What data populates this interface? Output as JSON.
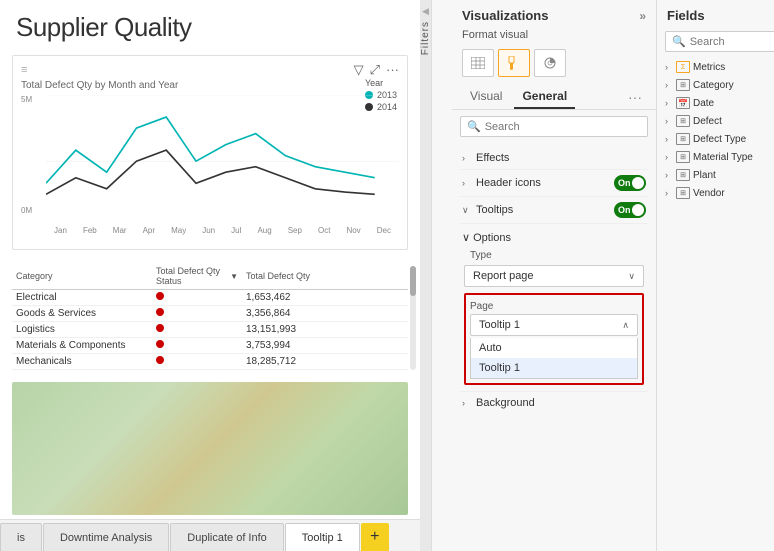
{
  "report": {
    "title": "Supplier Quality"
  },
  "chart": {
    "title": "Total Defect Qty by Month and Year",
    "y_labels": [
      "5M",
      "0M"
    ],
    "x_labels": [
      "Jan",
      "Feb",
      "Mar",
      "Apr",
      "May",
      "Jun",
      "Jul",
      "Aug",
      "Sep",
      "Oct",
      "Nov",
      "Dec"
    ],
    "legend": {
      "year_label": "Year",
      "items": [
        {
          "year": "2013",
          "color": "#00b4b4"
        },
        {
          "year": "2014",
          "color": "#333333"
        }
      ]
    }
  },
  "table": {
    "headers": [
      "Category",
      "Total Defect\nQty Status",
      "Total Defect\nQty"
    ],
    "rows": [
      {
        "category": "Electrical",
        "qty": "1,653,462"
      },
      {
        "category": "Goods & Services",
        "qty": "3,356,864"
      },
      {
        "category": "Logistics",
        "qty": "13,151,993"
      },
      {
        "category": "Materials & Components",
        "qty": "3,753,994"
      },
      {
        "category": "Mechanicals",
        "qty": "18,285,712"
      }
    ]
  },
  "tabs": {
    "items": [
      "is",
      "Downtime Analysis",
      "Duplicate of Info",
      "Tooltip 1"
    ],
    "active": "Tooltip 1",
    "add_label": "+"
  },
  "visualizations_panel": {
    "title": "Visualizations",
    "expand_icon": "»",
    "format_visual_label": "Format visual",
    "icons": [
      {
        "name": "table-icon",
        "symbol": "⊞",
        "active": false
      },
      {
        "name": "paint-icon",
        "symbol": "🖌",
        "active": true
      },
      {
        "name": "analytics-icon",
        "symbol": "📊",
        "active": false
      }
    ],
    "tabs": [
      {
        "name": "visual-tab",
        "label": "Visual"
      },
      {
        "name": "general-tab",
        "label": "General",
        "active": true
      }
    ],
    "more_label": "...",
    "search_placeholder": "Search",
    "sections": [
      {
        "name": "effects",
        "label": "Effects",
        "chevron": "›",
        "expanded": false
      },
      {
        "name": "header-icons",
        "label": "Header icons",
        "toggle": true,
        "toggle_on": true
      },
      {
        "name": "tooltips",
        "label": "Tooltips",
        "chevron": "∨",
        "toggle": true,
        "toggle_on": true,
        "expanded": true
      }
    ],
    "options": {
      "label": "Options",
      "type_label": "Type",
      "type_value": "Report page",
      "page_label": "Page",
      "page_value": "Tooltip 1",
      "page_options": [
        "Auto",
        "Tooltip 1"
      ]
    },
    "background": {
      "label": "Background",
      "chevron": "›"
    }
  },
  "fields_panel": {
    "title": "Fields",
    "search_placeholder": "Search",
    "items": [
      {
        "name": "Metrics",
        "icon_type": "metrics",
        "has_expand": true
      },
      {
        "name": "Category",
        "icon_type": "table",
        "has_expand": true
      },
      {
        "name": "Date",
        "icon_type": "table",
        "has_expand": true,
        "badge": "date"
      },
      {
        "name": "Defect",
        "icon_type": "table",
        "has_expand": true
      },
      {
        "name": "Defect Type",
        "icon_type": "table",
        "has_expand": true
      },
      {
        "name": "Material Type",
        "icon_type": "table",
        "has_expand": true
      },
      {
        "name": "Plant",
        "icon_type": "table",
        "has_expand": true
      },
      {
        "name": "Vendor",
        "icon_type": "table",
        "has_expand": true
      }
    ]
  },
  "filters_label": "Filters"
}
